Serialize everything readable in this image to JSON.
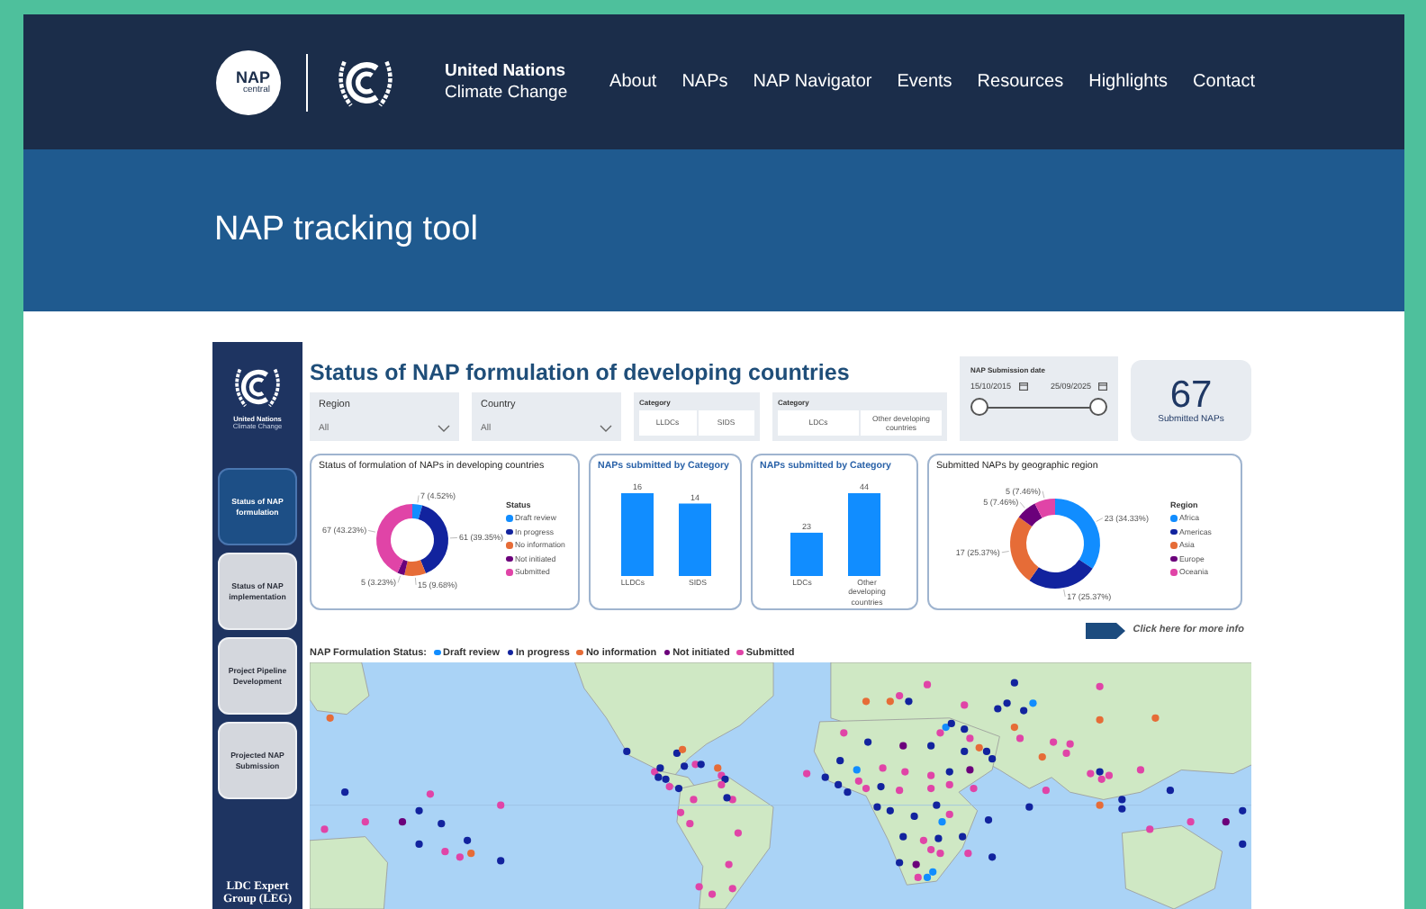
{
  "site_header": {
    "logo_text": "NAP",
    "logo_subtext": "central",
    "org_name": "United Nations",
    "org_subname": "Climate Change",
    "nav": [
      {
        "label": "About"
      },
      {
        "label": "NAPs"
      },
      {
        "label": "NAP Navigator"
      },
      {
        "label": "Events"
      },
      {
        "label": "Resources"
      },
      {
        "label": "Highlights"
      },
      {
        "label": "Contact"
      }
    ]
  },
  "banner": {
    "title": "NAP tracking tool"
  },
  "dashboard": {
    "sidebar": {
      "org_name": "United Nations",
      "org_subname": "Climate Change",
      "items": [
        {
          "label": "Status of NAP formulation",
          "selected": true
        },
        {
          "label": "Status of NAP implementation",
          "selected": false
        },
        {
          "label": "Project Pipeline Development",
          "selected": false
        },
        {
          "label": "Projected NAP Submission",
          "selected": false
        }
      ],
      "footer": "LDC Expert Group (LEG)"
    },
    "title": "Status of NAP formulation of developing countries",
    "filters": [
      {
        "kind": "dropdown",
        "label": "Region",
        "value": "All"
      },
      {
        "kind": "dropdown",
        "label": "Country",
        "value": "All"
      },
      {
        "kind": "buttons",
        "label": "Category",
        "options": [
          "LLDCs",
          "SIDS"
        ]
      },
      {
        "kind": "buttons",
        "label": "Category",
        "options": [
          "LDCs",
          "Other developing countries"
        ]
      },
      {
        "kind": "date_range",
        "label": "NAP Submission date",
        "start": "15/10/2015",
        "end": "25/09/2025",
        "thumbs": [
          {
            "level": 0
          },
          {
            "level": 1
          }
        ]
      }
    ],
    "kpi": {
      "value": "67",
      "label": "Submitted NAPs"
    },
    "charts": [
      {
        "chart_data": {
          "type": "donut",
          "title": "Status of formulation of NAPs in developing countries",
          "categories": [
            "Draft review",
            "In progress",
            "No information",
            "Not initiated",
            "Submitted"
          ],
          "values": [
            7,
            61,
            15,
            5,
            67
          ],
          "colors": [
            "#118dff",
            "#12239e",
            "#e66c37",
            "#6b007b",
            "#e044a7"
          ],
          "legend": {
            "title": "Status"
          },
          "value_labels": [
            "7 (4.52%)",
            "61 (39.35%)",
            "15 (9.68%)",
            "5 (3.23%)",
            "67 (43.23%)"
          ]
        }
      },
      {
        "chart_data": {
          "type": "bar",
          "title": "NAPs submitted by Category",
          "categories": [
            "LLDCs",
            "SIDS"
          ],
          "values": [
            16,
            14
          ],
          "data_labels": true
        }
      },
      {
        "chart_data": {
          "type": "bar",
          "title": "NAPs submitted by Category",
          "categories": [
            "LDCs",
            "Other developing countries"
          ],
          "values": [
            23,
            44
          ],
          "data_labels": true
        }
      },
      {
        "chart_data": {
          "type": "donut",
          "title": "Submitted NAPs by geographic region",
          "categories": [
            "Africa",
            "Americas",
            "Asia",
            "Europe",
            "Oceania"
          ],
          "values": [
            23,
            17,
            17,
            5,
            5
          ],
          "colors": [
            "#118dff",
            "#12239e",
            "#e66c37",
            "#6b007b",
            "#e044a7"
          ],
          "legend": {
            "title": "Region"
          },
          "value_labels": [
            "23 (34.33%)",
            "17 (25.37%)",
            "17 (25.37%)",
            "5 (7.46%)",
            "5 (7.46%)"
          ]
        }
      }
    ],
    "more_info": "Click here for more info",
    "map": {
      "legend_label": "NAP Formulation Status:",
      "legend": [
        {
          "label": "Draft review",
          "color": "#118dff"
        },
        {
          "label": "In progress",
          "color": "#12239e"
        },
        {
          "label": "No information",
          "color": "#e66c37"
        },
        {
          "label": "Not initiated",
          "color": "#6b007b"
        },
        {
          "label": "Submitted",
          "color": "#e044a7"
        }
      ]
    }
  }
}
